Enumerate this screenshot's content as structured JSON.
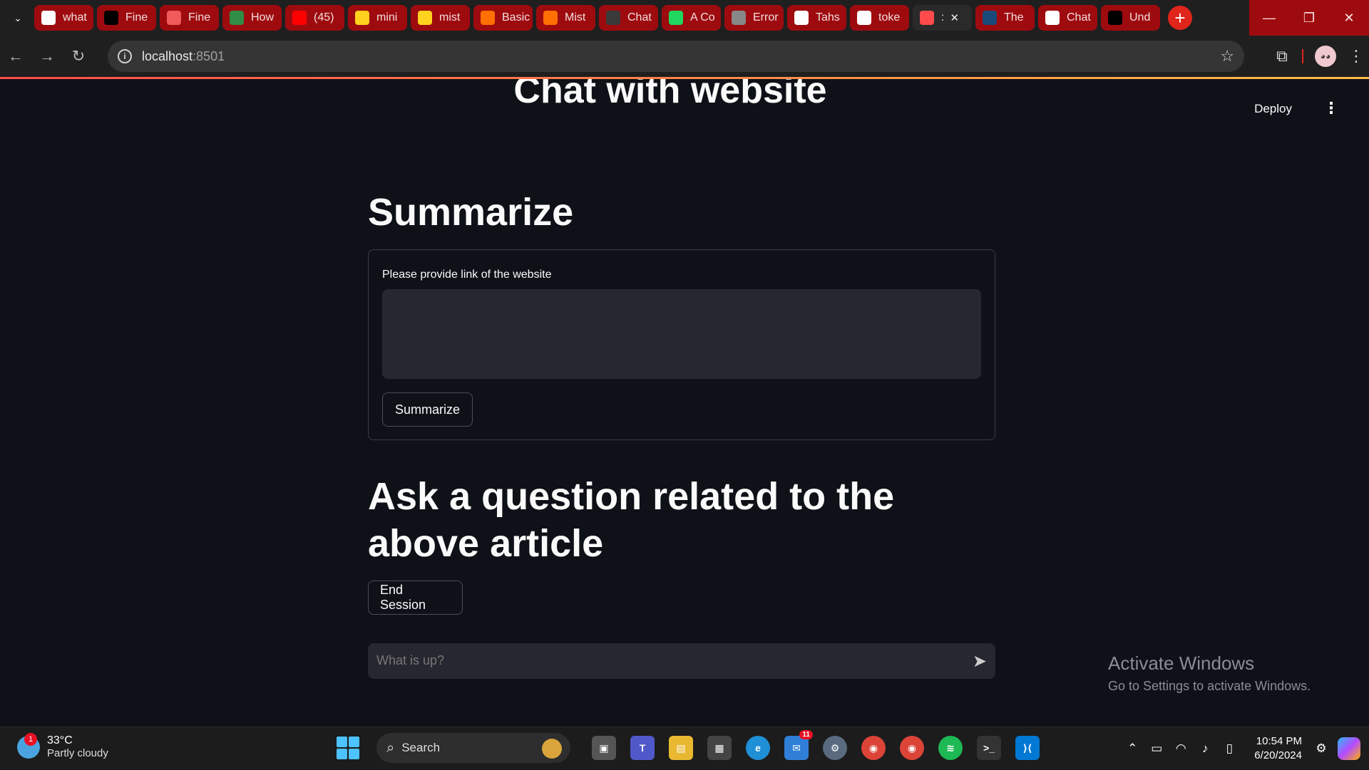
{
  "browser": {
    "tabs": [
      {
        "title": "what",
        "favicon": "google-icon",
        "color": "#ffffff"
      },
      {
        "title": "Fine",
        "favicon": "medium-icon",
        "color": "#000000"
      },
      {
        "title": "Fine",
        "favicon": "s-logo-icon",
        "color": "#f05a5a"
      },
      {
        "title": "How",
        "favicon": "geeks-icon",
        "color": "#2f8d46"
      },
      {
        "title": "(45)",
        "favicon": "youtube-icon",
        "color": "#ff0000"
      },
      {
        "title": "mini",
        "favicon": "huggingface-icon",
        "color": "#ffd21e"
      },
      {
        "title": "mist",
        "favicon": "huggingface-icon",
        "color": "#ffd21e"
      },
      {
        "title": "Basic",
        "favicon": "m-logo-icon",
        "color": "#ff7000"
      },
      {
        "title": "Mist",
        "favicon": "m-logo-icon",
        "color": "#ff7000"
      },
      {
        "title": "Chat",
        "favicon": "bot-icon",
        "color": "#3a3a3a"
      },
      {
        "title": "A Co",
        "favicon": "k-logo-icon",
        "color": "#20d760"
      },
      {
        "title": "Error",
        "favicon": "globe-icon",
        "color": "#888888"
      },
      {
        "title": "Tahs",
        "favicon": "github-icon",
        "color": "#ffffff"
      },
      {
        "title": "toke",
        "favicon": "github-icon",
        "color": "#ffffff"
      },
      {
        "title": ":",
        "favicon": "streamlit-icon",
        "color": "#ff4b4b",
        "active": true
      },
      {
        "title": "The",
        "favicon": "tds-icon",
        "color": "#1a4a7a"
      },
      {
        "title": "Chat",
        "favicon": "openai-icon",
        "color": "#ffffff"
      },
      {
        "title": "Und",
        "favicon": "medium-icon",
        "color": "#000000"
      }
    ],
    "url_host": "localhost",
    "url_port": ":8501"
  },
  "app": {
    "deploy_label": "Deploy",
    "partial_title": "Chat with website",
    "summarize_heading": "Summarize",
    "link_label": "Please provide link of the website",
    "link_value": "",
    "summarize_button": "Summarize",
    "ask_heading": "Ask a question related to the above article",
    "end_session_button": "End Session",
    "chat_placeholder": "What is up?",
    "activate_title": "Activate Windows",
    "activate_sub": "Go to Settings to activate Windows."
  },
  "taskbar": {
    "temperature": "33°C",
    "weather": "Partly cloudy",
    "weather_badge": "1",
    "search_label": "Search",
    "mail_count": "11",
    "time": "10:54 PM",
    "date": "6/20/2024"
  },
  "colors": {
    "accent": "#ff4b4b",
    "tab_bg": "#9e0b0f",
    "app_bg": "#0e1117"
  }
}
